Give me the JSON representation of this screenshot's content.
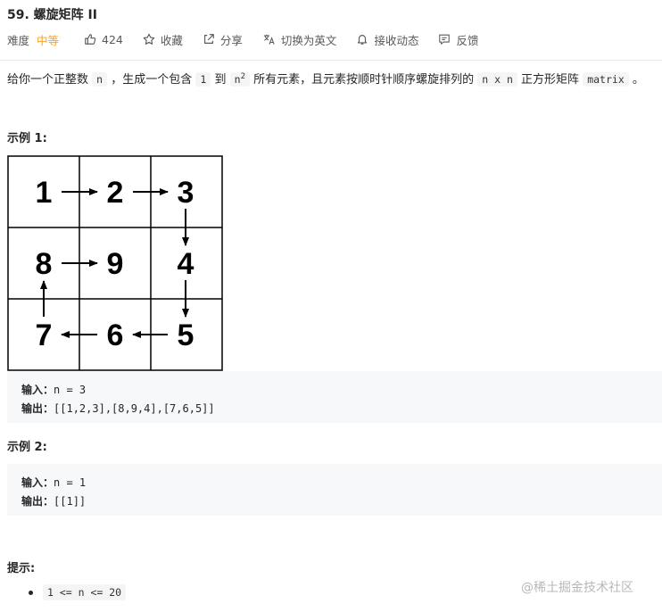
{
  "problem": {
    "title": "59. 螺旋矩阵 II",
    "difficulty_label": "难度",
    "difficulty": "中等",
    "likes": "424",
    "favorite": "收藏",
    "share": "分享",
    "switch_lang": "切换为英文",
    "notify": "接收动态",
    "feedback": "反馈"
  },
  "description": {
    "t1": "给你一个正整数",
    "c1": "n",
    "t2": "，生成一个包含",
    "c2": "1",
    "t3": "到",
    "c3": "n",
    "sup": "2",
    "t4": "所有元素，且元素按顺时针顺序螺旋排列的",
    "c4": "n x n",
    "t5": "正方形矩阵",
    "c5": "matrix",
    "t6": "。"
  },
  "example1": {
    "heading": "示例 1:",
    "grid": [
      "1",
      "2",
      "3",
      "8",
      "9",
      "4",
      "7",
      "6",
      "5"
    ],
    "input_label": "输入：",
    "input": "n = 3",
    "output_label": "输出：",
    "output": "[[1,2,3],[8,9,4],[7,6,5]]"
  },
  "example2": {
    "heading": "示例 2:",
    "input_label": "输入：",
    "input": "n = 1",
    "output_label": "输出：",
    "output": "[[1]]"
  },
  "hints": {
    "heading": "提示:",
    "items": [
      "1 <= n <= 20"
    ]
  },
  "watermark": "@稀土掘金技术社区",
  "colors": {
    "difficulty": "#ffa116",
    "code_bg": "#f7f8fa",
    "text": "#262626"
  }
}
